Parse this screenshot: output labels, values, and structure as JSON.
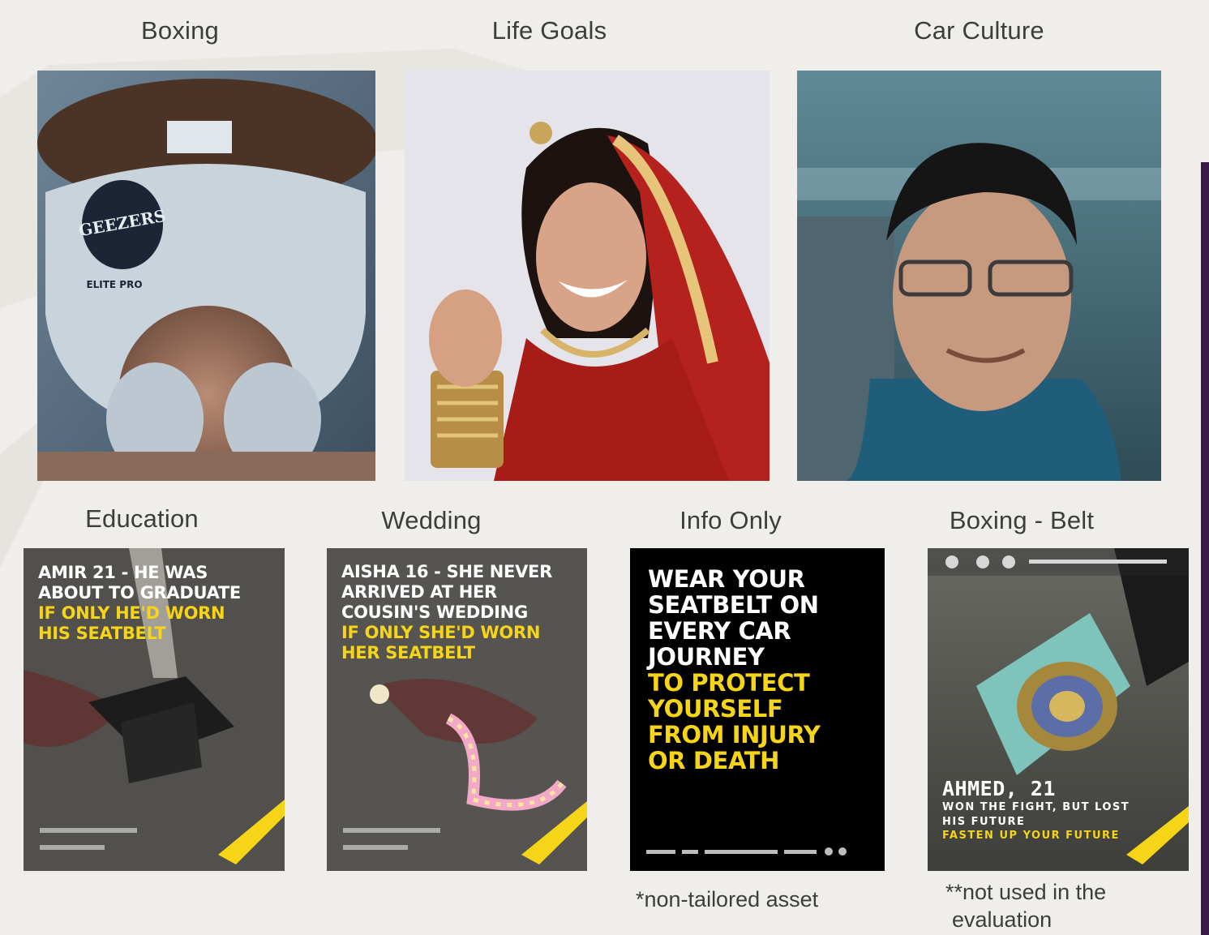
{
  "labels": {
    "boxing": "Boxing",
    "life_goals": "Life Goals",
    "car_culture": "Car Culture",
    "education": "Education",
    "wedding": "Wedding",
    "info_only": "Info Only",
    "boxing_belt": "Boxing - Belt"
  },
  "posters": {
    "education": {
      "line1": "AMIR 21 - HE WAS",
      "line2": "ABOUT TO GRADUATE",
      "line3": "IF ONLY HE'D WORN",
      "line4": "HIS SEATBELT"
    },
    "wedding": {
      "line1": "AISHA 16 - SHE NEVER",
      "line2": "ARRIVED AT HER",
      "line3": "COUSIN'S WEDDING",
      "line4": "IF ONLY SHE'D WORN",
      "line5": "HER SEATBELT"
    },
    "info": {
      "line1": "WEAR YOUR",
      "line2": "SEATBELT ON",
      "line3": "EVERY CAR",
      "line4": "JOURNEY",
      "line5": "TO PROTECT",
      "line6": "YOURSELF",
      "line7": "FROM INJURY",
      "line8": "OR DEATH"
    },
    "belt": {
      "name": "AHMED, 21",
      "line1": "WON THE FIGHT, BUT LOST",
      "line2": "HIS FUTURE",
      "tagline": "FASTEN UP YOUR FUTURE"
    }
  },
  "photo_text": {
    "headgear_brand": "GEEZERS",
    "headgear_model": "ELITE PRO"
  },
  "notes": {
    "info_only": "*non-tailored asset",
    "belt_line1": "**not used in the",
    "belt_line2": "evaluation"
  },
  "colors": {
    "background": "#efeeea",
    "poster_yellow": "#f6d417",
    "accent_bar": "#3a1a46"
  }
}
